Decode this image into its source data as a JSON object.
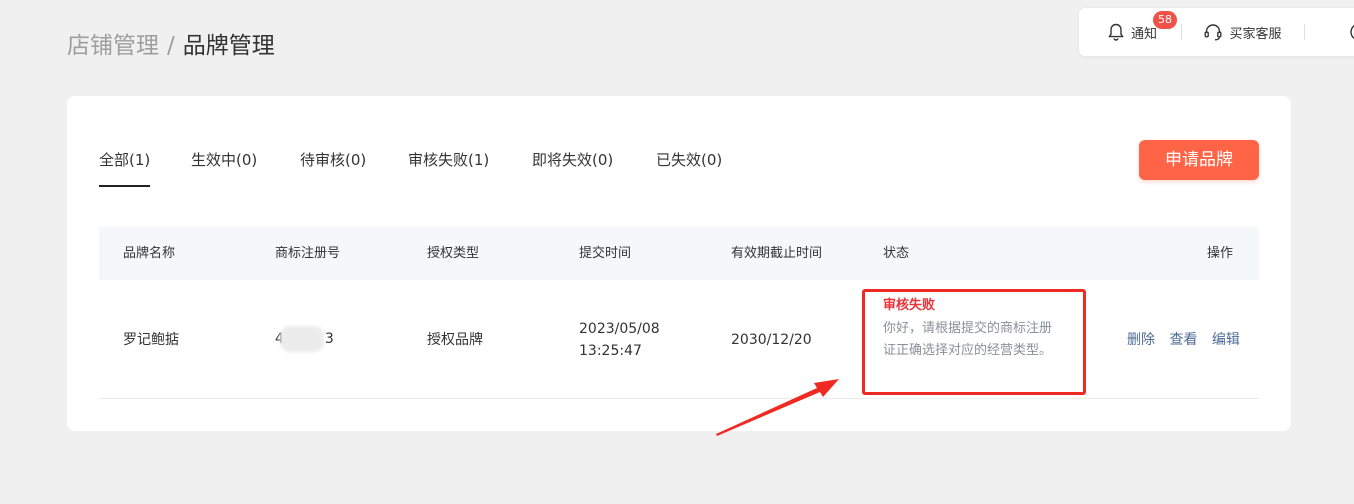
{
  "breadcrumb": {
    "parent": "店铺管理",
    "separator": "/",
    "current": "品牌管理"
  },
  "topbar": {
    "notify_label": "通知",
    "notify_count": "58",
    "service_label": "买家客服",
    "help_glyph": "?"
  },
  "tabs": [
    {
      "label": "全部(1)",
      "active": true
    },
    {
      "label": "生效中(0)"
    },
    {
      "label": "待审核(0)"
    },
    {
      "label": "审核失败(1)"
    },
    {
      "label": "即将失效(0)"
    },
    {
      "label": "已失效(0)"
    }
  ],
  "apply_button": "申请品牌",
  "table": {
    "headers": [
      "品牌名称",
      "商标注册号",
      "授权类型",
      "提交时间",
      "有效期截止时间",
      "状态",
      "操作"
    ],
    "rows": [
      {
        "brand_name": "罗记鲍掂",
        "reg_no_prefix": "4",
        "reg_no_suffix": "3",
        "auth_type": "授权品牌",
        "submit_date": "2023/05/08",
        "submit_time": "13:25:47",
        "expiry": "2030/12/20",
        "status_title": "审核失败",
        "status_desc": "你好，请根据提交的商标注册证正确选择对应的经营类型。",
        "actions": [
          "删除",
          "查看",
          "编辑"
        ]
      }
    ]
  },
  "colors": {
    "accent": "#ff6446",
    "status_fail": "#e8343a",
    "highlight_box": "#ee2a22",
    "badge": "#f0524a",
    "link": "#4e6a96"
  },
  "icons": [
    "bell-icon",
    "headset-icon",
    "help-icon",
    "red-arrow-annotation"
  ]
}
